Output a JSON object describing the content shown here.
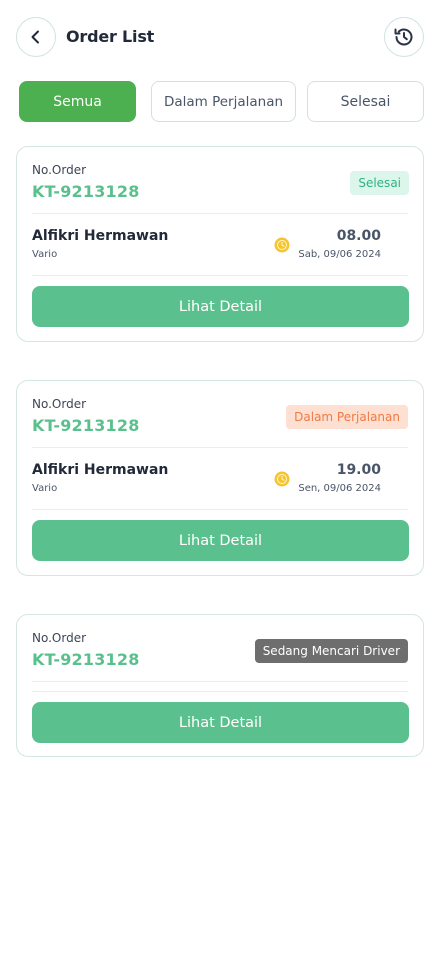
{
  "header": {
    "title": "Order List",
    "back_icon": "chevron-left-icon",
    "history_icon": "history-icon"
  },
  "tabs": [
    {
      "label": "Semua",
      "active": true
    },
    {
      "label": "Dalam Perjalanan",
      "active": false
    },
    {
      "label": "Selesai",
      "active": false
    }
  ],
  "orders": [
    {
      "order_label": "No.Order",
      "order_id": "KT-9213128",
      "status": "Selesai",
      "driver_name": "Alfikri Hermawan",
      "vehicle": "Vario",
      "time": "08.00",
      "date": "Sab, 09/06 2024",
      "button_label": "Lihat Detail"
    },
    {
      "order_label": "No.Order",
      "order_id": "KT-9213128",
      "status": "Dalam Perjalanan",
      "driver_name": "Alfikri Hermawan",
      "vehicle": "Vario",
      "time": "19.00",
      "date": "Sen, 09/06 2024",
      "button_label": "Lihat Detail"
    },
    {
      "order_label": "No.Order",
      "order_id": "KT-9213128",
      "status": "Sedang Mencari Driver",
      "button_label": "Lihat Detail"
    }
  ],
  "colors": {
    "primary_green": "#4caf50",
    "button_green": "#5ac18e",
    "status_done": "#2eb384",
    "status_progress": "#f07a43",
    "status_searching": "#6e6e6e",
    "clock_yellow": "#f5c531"
  }
}
